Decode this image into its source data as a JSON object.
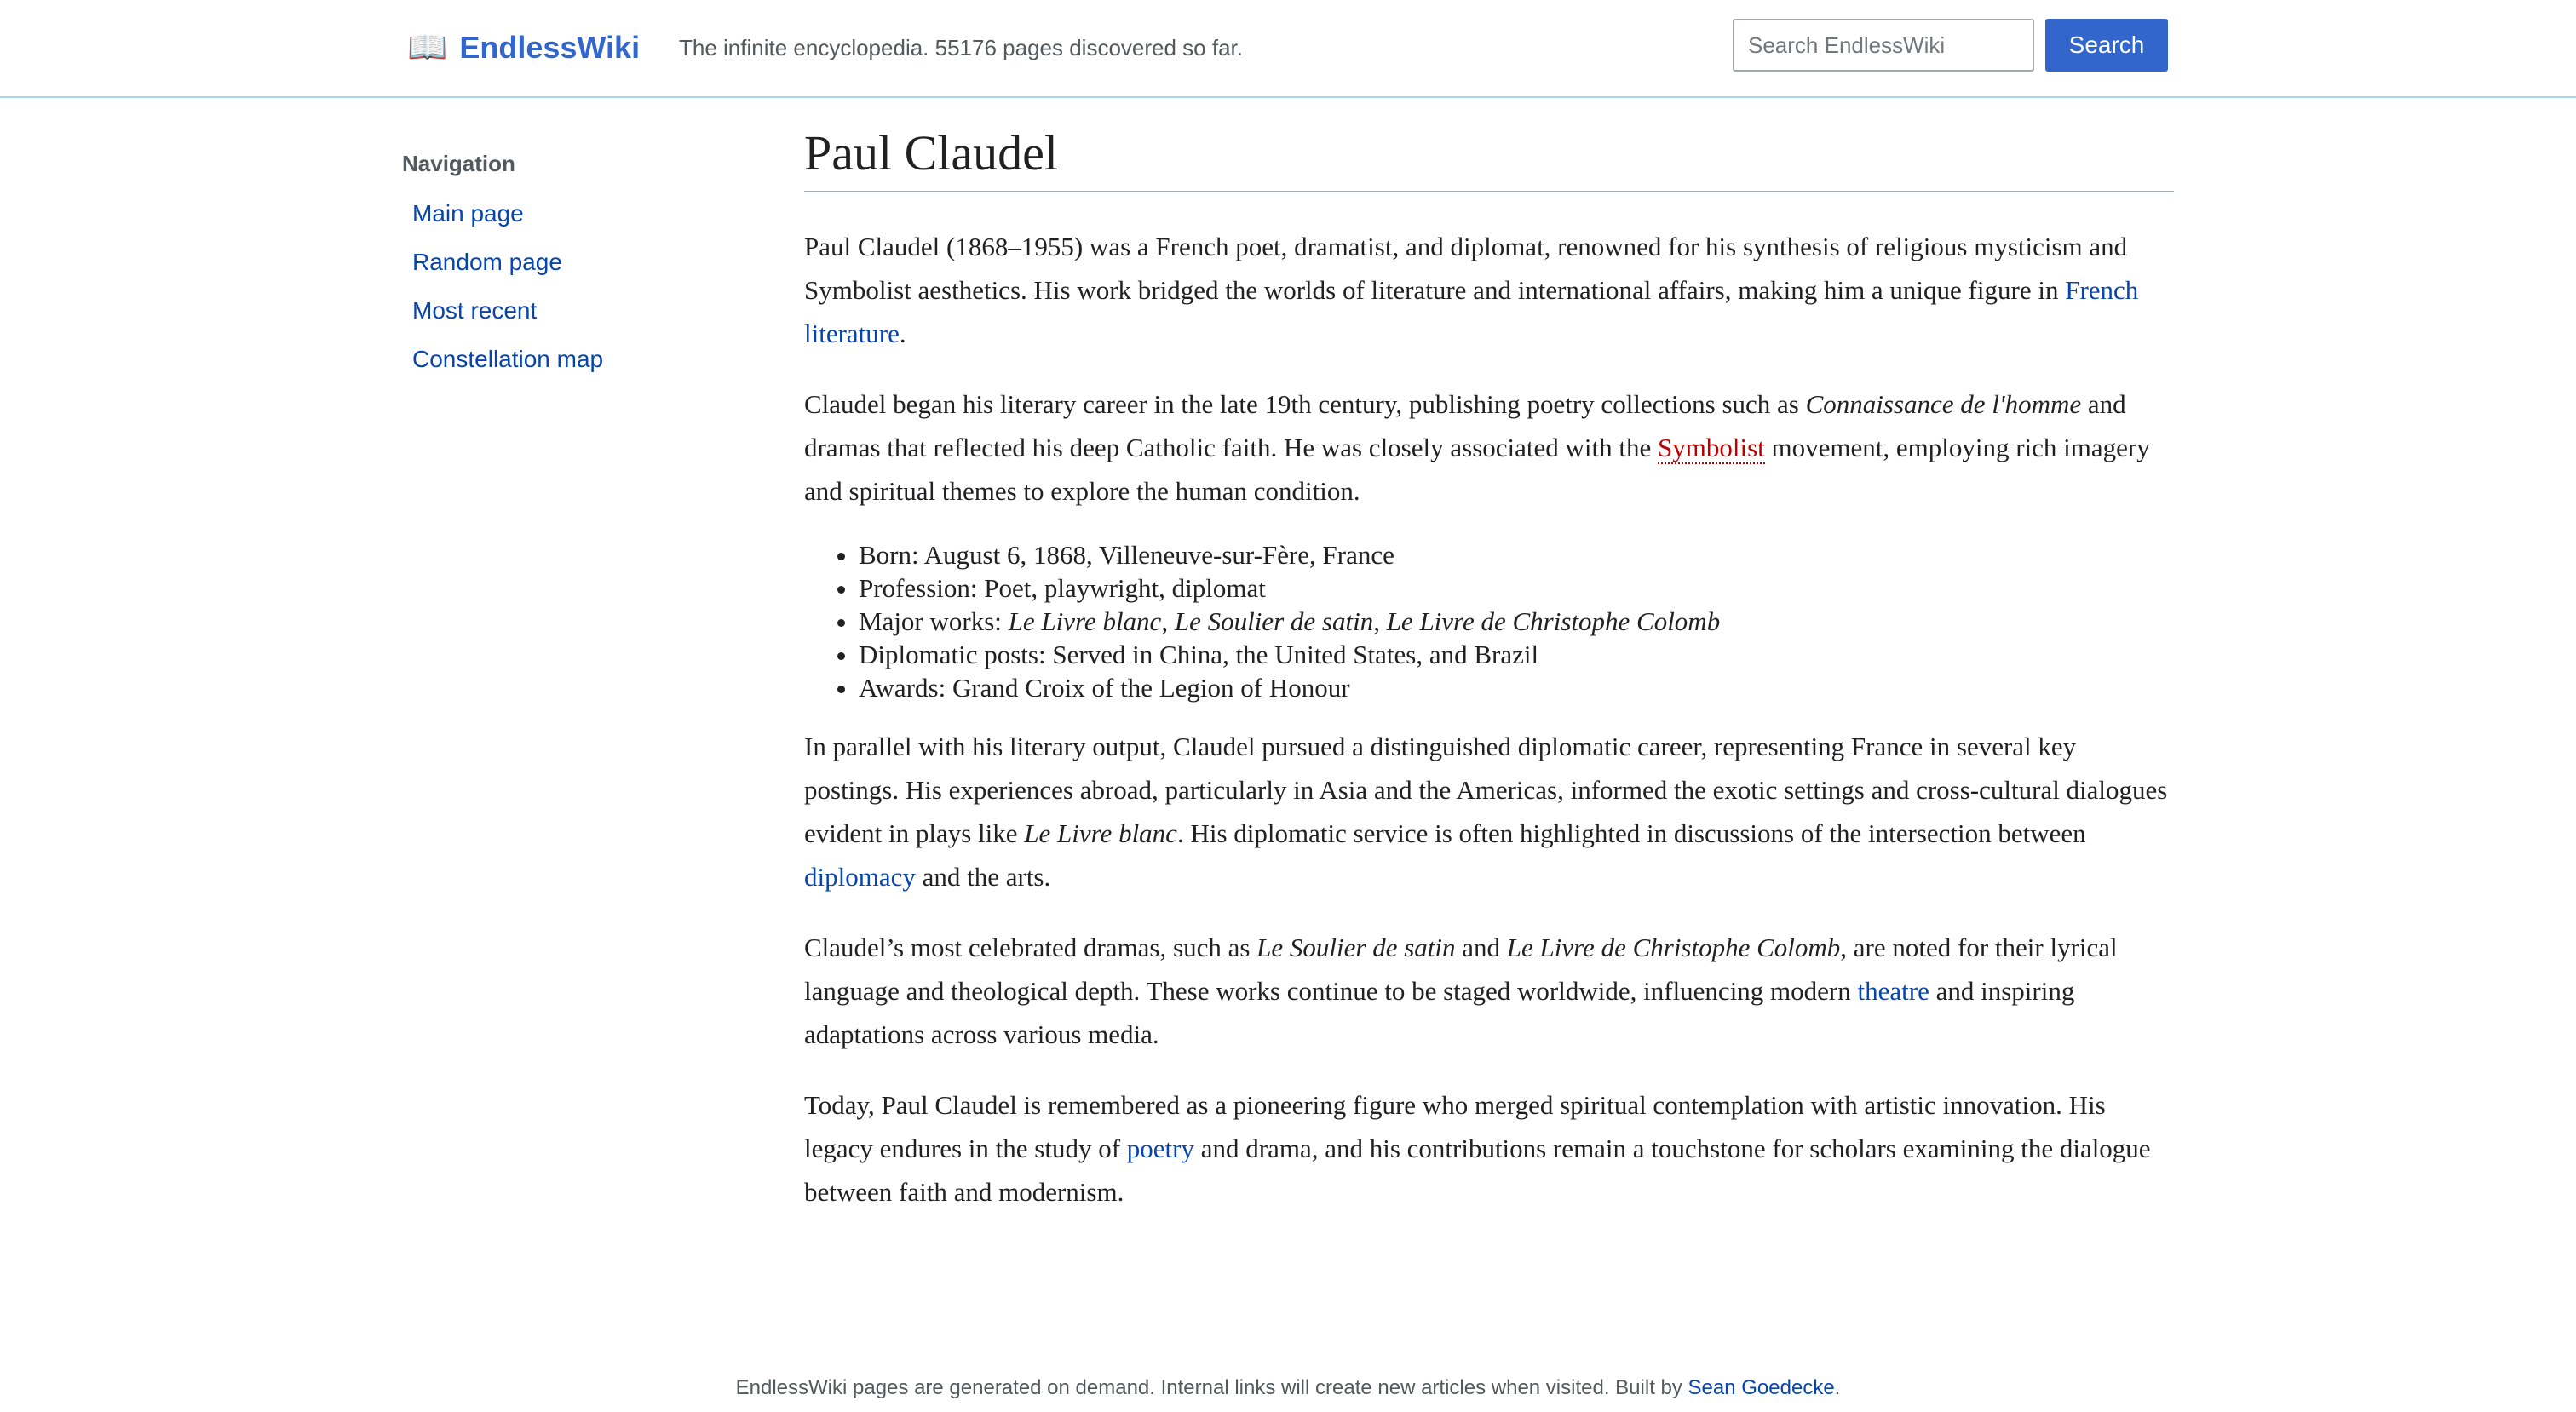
{
  "header": {
    "logo_icon": "📖",
    "logo_icon_name": "open-book-icon",
    "logo_text": "EndlessWiki",
    "tagline": "The infinite encyclopedia. 55176 pages discovered so far.",
    "search_placeholder": "Search EndlessWiki",
    "search_value": "",
    "search_button_label": "Search"
  },
  "sidebar": {
    "heading": "Navigation",
    "items": [
      {
        "label": "Main page"
      },
      {
        "label": "Random page"
      },
      {
        "label": "Most recent"
      },
      {
        "label": "Constellation map"
      }
    ]
  },
  "article": {
    "title": "Paul Claudel",
    "p1": {
      "text": "Paul Claudel (1868–1955) was a French poet, dramatist, and diplomat, renowned for his synthesis of religious mysticism and Symbolist aesthetics. His work bridged the worlds of literature and international affairs, making him a unique figure in ",
      "link": "French literature",
      "end": "."
    },
    "p2": {
      "text_a": "Claudel began his literary career in the late 19th century, publishing poetry collections such as ",
      "italic_a": "Connaissance de l'homme",
      "text_b": " and dramas that reflected his deep Catholic faith. He was closely associated with the ",
      "link_red": "Symbolist",
      "text_c": " movement, employing rich imagery and spiritual themes to explore the human condition."
    },
    "facts": {
      "born": "Born: August 6, 1868, Villeneuve-sur-Fère, France",
      "profession": "Profession: Poet, playwright, diplomat",
      "major_label": "Major works: ",
      "major_work_1": "Le Livre blanc",
      "major_sep_1": ", ",
      "major_work_2": "Le Soulier de satin",
      "major_sep_2": ", ",
      "major_work_3": "Le Livre de Christophe Colomb",
      "diplomatic": "Diplomatic posts: Served in China, the United States, and Brazil",
      "awards": "Awards: Grand Croix of the Legion of Honour"
    },
    "p3": {
      "text_a": "In parallel with his literary output, Claudel pursued a distinguished diplomatic career, representing France in several key postings. His experiences abroad, particularly in Asia and the Americas, informed the exotic settings and cross-cultural dialogues evident in plays like ",
      "italic_a": "Le Livre blanc",
      "text_b": ". His diplomatic service is often highlighted in discussions of the intersection between ",
      "link": "diplomacy",
      "text_c": " and the arts."
    },
    "p4": {
      "text_a": "Claudel’s most celebrated dramas, such as ",
      "italic_a": "Le Soulier de satin",
      "text_b": " and ",
      "italic_b": "Le Livre de Christophe Colomb",
      "text_c": ", are noted for their lyrical language and theological depth. These works continue to be staged worldwide, influencing modern ",
      "link": "theatre",
      "text_d": " and inspiring adaptations across various media."
    },
    "p5": {
      "text_a": "Today, Paul Claudel is remembered as a pioneering figure who merged spiritual contemplation with artistic innovation. His legacy endures in the study of ",
      "link": "poetry",
      "text_b": " and drama, and his contributions remain a touchstone for scholars examining the dialogue between faith and modernism."
    }
  },
  "footer": {
    "text": "EndlessWiki pages are generated on demand. Internal links will create new articles when visited. Built by ",
    "link": "Sean Goedecke",
    "end": "."
  },
  "colors": {
    "accent": "#3366cc",
    "link": "#0645ad",
    "redlink": "#ba0000",
    "header_border": "#a7d7f9"
  }
}
